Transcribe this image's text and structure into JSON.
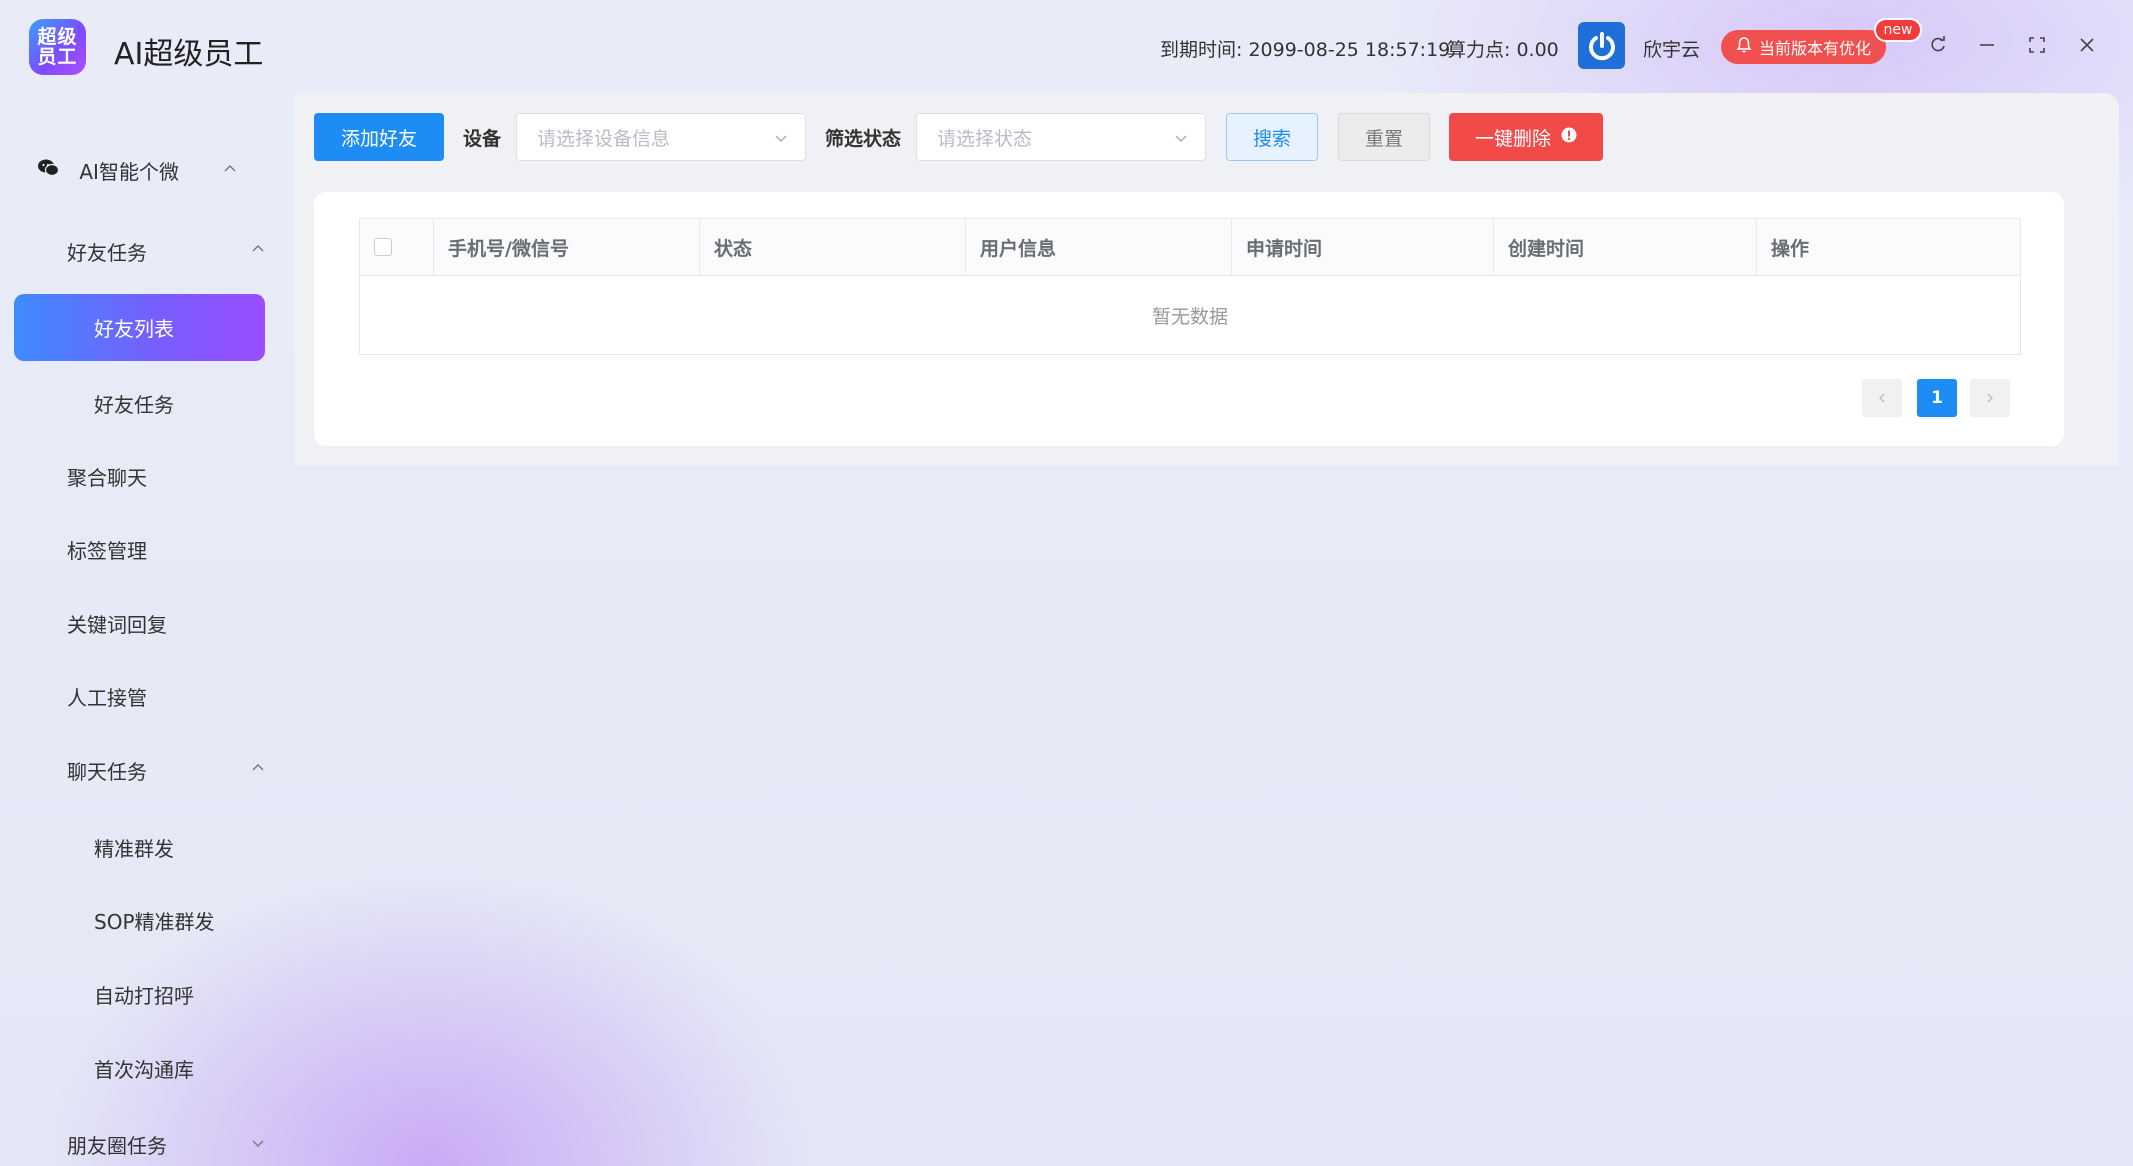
{
  "app": {
    "logo_line1": "超级",
    "logo_line2": "员工",
    "title": "AI超级员工"
  },
  "header": {
    "expire_label": "到期时间:",
    "expire_value": "2099-08-25 18:57:19",
    "points_label": "算力点:",
    "points_value": "0.00",
    "company": "欣宇云",
    "update_badge": "当前版本有优化",
    "new_tag": "new"
  },
  "sidebar": {
    "ai_personal_wechat": "AI智能个微",
    "friend_task_group": "好友任务",
    "friend_list": "好友列表",
    "friend_task": "好友任务",
    "aggregate_chat": "聚合聊天",
    "tag_manage": "标签管理",
    "keyword_reply": "关键词回复",
    "manual_takeover": "人工接管",
    "chat_task_group": "聊天任务",
    "precise_broadcast": "精准群发",
    "sop_broadcast": "SOP精准群发",
    "auto_greet": "自动打招呼",
    "first_comm_lib": "首次沟通库",
    "moments_task": "朋友圈任务"
  },
  "toolbar": {
    "add_friend": "添加好友",
    "device_label": "设备",
    "device_placeholder": "请选择设备信息",
    "status_label": "筛选状态",
    "status_placeholder": "请选择状态",
    "search": "搜索",
    "reset": "重置",
    "delete_all": "一键删除"
  },
  "table": {
    "columns": [
      "手机号/微信号",
      "状态",
      "用户信息",
      "申请时间",
      "创建时间",
      "操作"
    ],
    "empty_text": "暂无数据"
  },
  "pagination": {
    "current_page": "1"
  },
  "colors": {
    "primary": "#1e8cf5",
    "danger": "#f24949",
    "active_menu_start": "#3e8bff",
    "active_menu_end": "#9a4dff"
  }
}
